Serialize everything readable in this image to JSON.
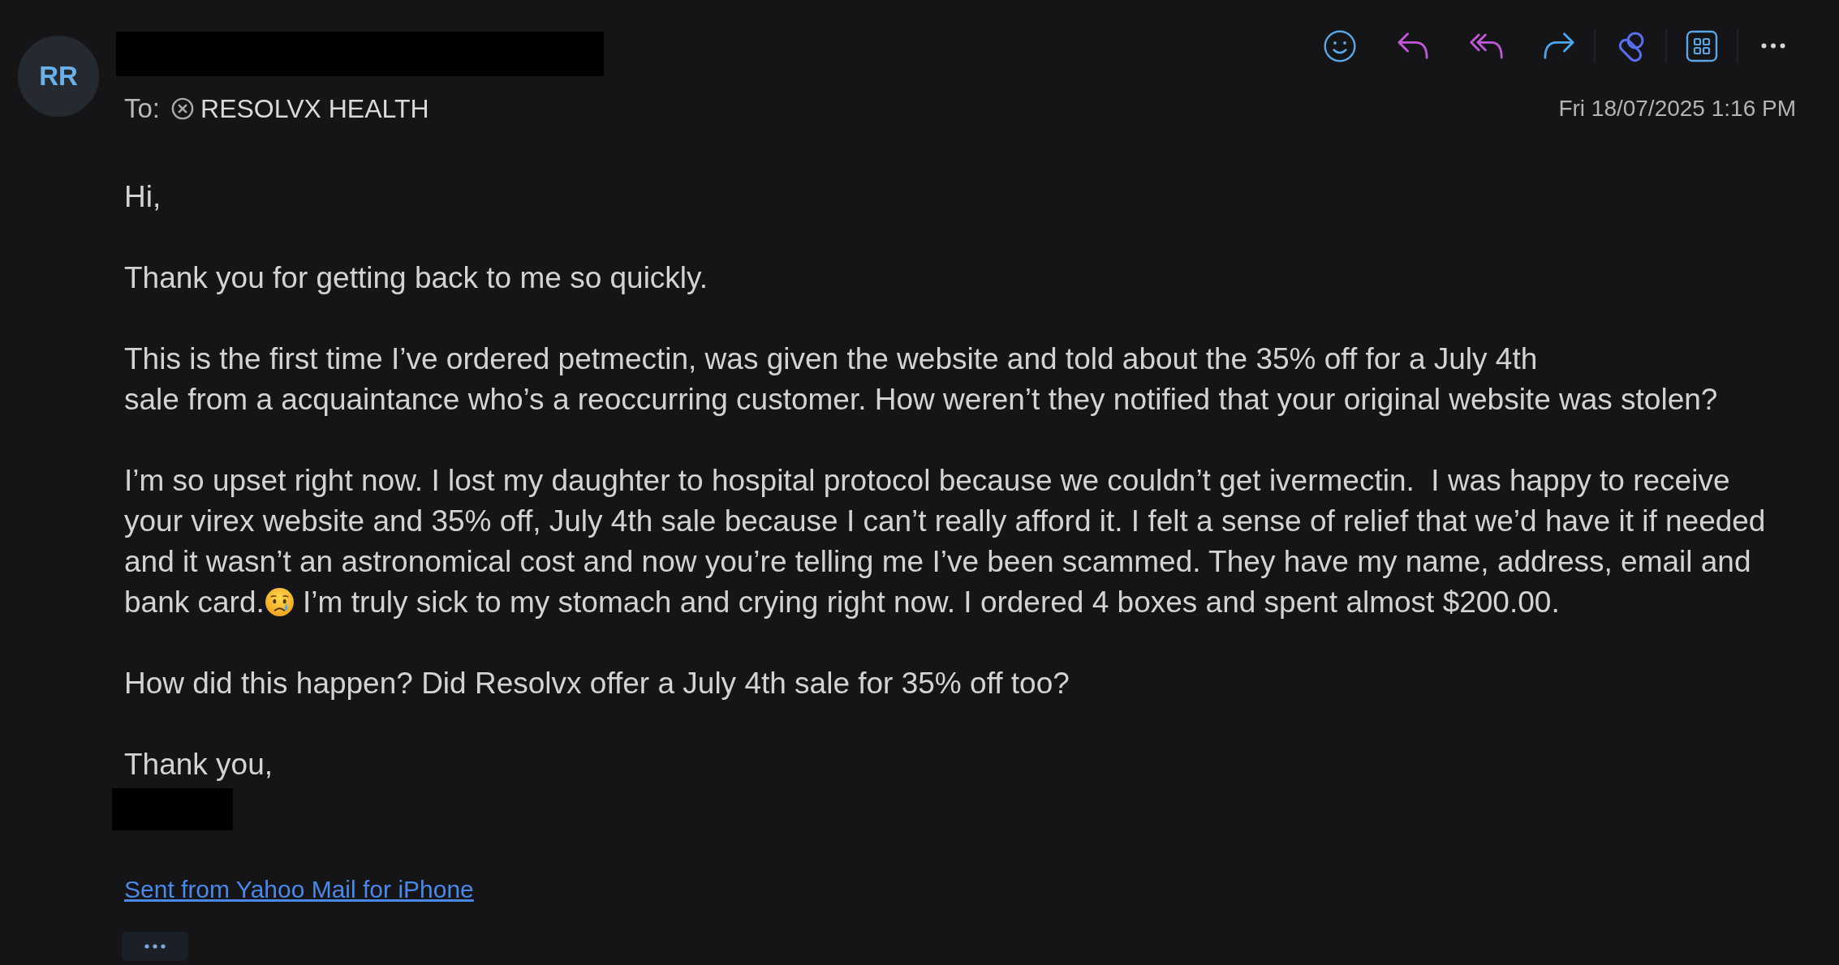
{
  "sender": {
    "initials": "RR"
  },
  "recipient": {
    "label": "To:",
    "name": "RESOLVX HEALTH"
  },
  "date": "Fri 18/07/2025 1:16 PM",
  "body": {
    "paragraphs": [
      {
        "text": "Hi,"
      },
      {
        "text": "Thank you for getting back to me so quickly."
      },
      {
        "text": "This is the first time I’ve ordered petmectin, was given the website and told about the 35% off for a July 4th\nsale from a acquaintance who’s a reoccurring customer. How weren’t they notified that your original website was stolen?"
      },
      {
        "parts": [
          {
            "kind": "text",
            "text": "I’m so upset right now. I lost my daughter to hospital protocol because we couldn’t get ivermectin.  I was happy to receive your virex website and 35% off, July 4th sale because I can’t really afford it. I felt a sense of relief that we’d have it if needed and it wasn’t an astronomical cost and now you’re telling me I’ve been scammed. They have my name, address, email and bank card."
          },
          {
            "kind": "emoji"
          },
          {
            "kind": "text",
            "text": " I’m truly sick to my stomach and crying right now. I ordered 4 boxes and spent almost $200.00."
          }
        ]
      },
      {
        "text": "How did this happen? Did Resolvx offer a July 4th sale for 35% off too?"
      },
      {
        "text": "Thank you,"
      }
    ]
  },
  "signature_link": "Sent from Yahoo Mail for iPhone"
}
